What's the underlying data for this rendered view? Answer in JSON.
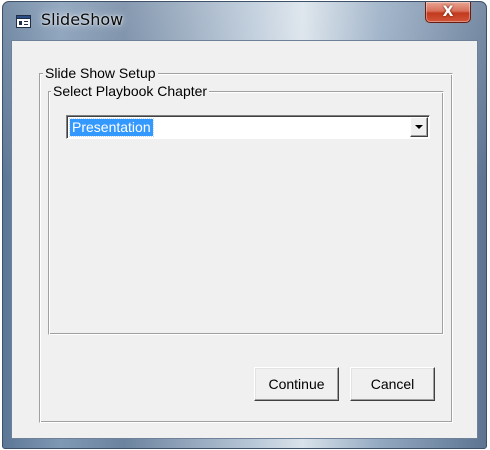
{
  "window": {
    "title": "SlideShow",
    "close_symbol": "X",
    "icon": "slideshow-app-icon",
    "close_button_color": "#c7472b"
  },
  "dialog": {
    "group_title": "Slide Show Setup",
    "chapter_group_title": "Select Playbook Chapter",
    "chapter_select": {
      "selected_value": "Presentation",
      "dropdown_icon": "triangle-down-icon",
      "highlight_color": "#3399ff"
    },
    "buttons": {
      "continue_label": "Continue",
      "cancel_label": "Cancel"
    }
  }
}
